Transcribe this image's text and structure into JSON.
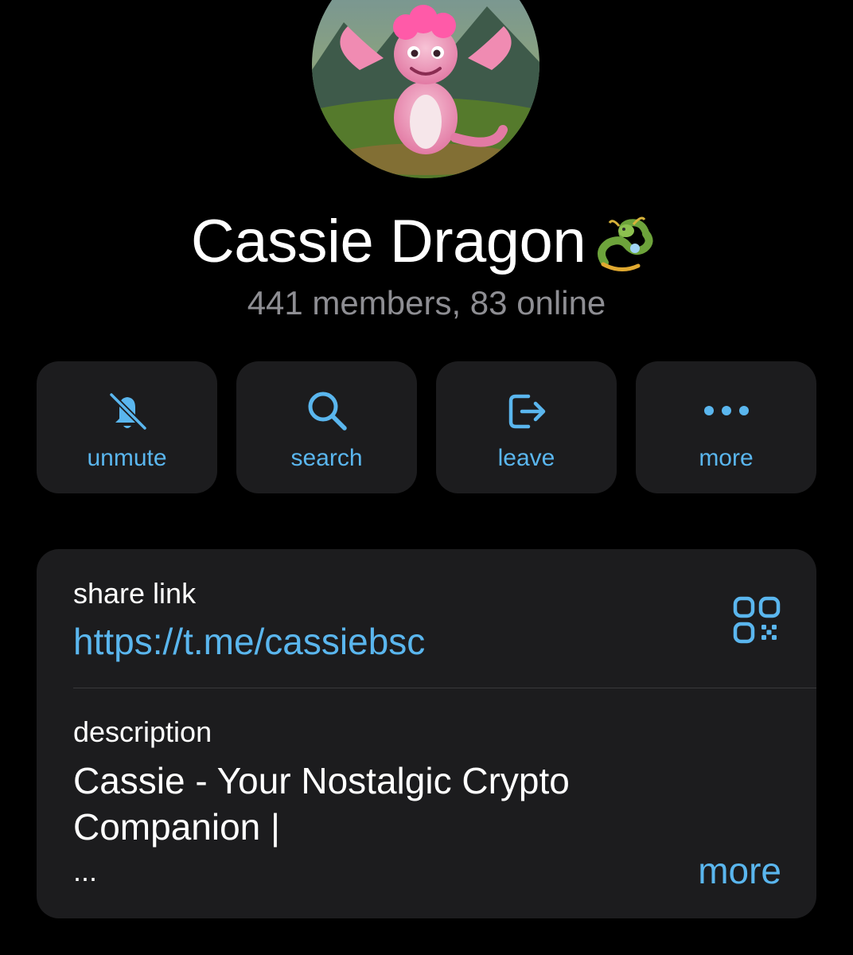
{
  "group": {
    "title": "Cassie Dragon",
    "title_emoji": "dragon-emoji",
    "subtitle": "441 members, 83 online"
  },
  "actions": [
    {
      "label": "unmute",
      "icon": "bell-slash-icon"
    },
    {
      "label": "search",
      "icon": "search-icon"
    },
    {
      "label": "leave",
      "icon": "leave-icon"
    },
    {
      "label": "more",
      "icon": "more-dots-icon"
    }
  ],
  "info": {
    "share_label": "share link",
    "share_value": "https://t.me/cassiebsc",
    "qr_icon": "qr-code-icon",
    "description_label": "description",
    "description_text": "Cassie - Your Nostalgic Crypto\nCompanion |",
    "ellipsis": "...",
    "more_label": "more"
  },
  "colors": {
    "background": "#000000",
    "card": "#1c1c1e",
    "accent": "#5ab6ee",
    "secondary_text": "#8e8e93",
    "separator": "#38383a"
  }
}
